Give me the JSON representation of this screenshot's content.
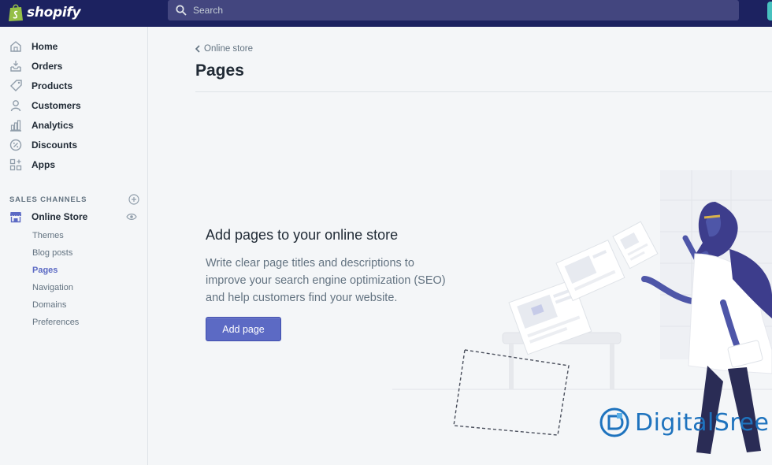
{
  "topbar": {
    "brand": "shopify",
    "search_placeholder": "Search"
  },
  "sidebar": {
    "items": [
      {
        "label": "Home",
        "icon": "home-icon"
      },
      {
        "label": "Orders",
        "icon": "orders-icon"
      },
      {
        "label": "Products",
        "icon": "tag-icon"
      },
      {
        "label": "Customers",
        "icon": "person-icon"
      },
      {
        "label": "Analytics",
        "icon": "bar-chart-icon"
      },
      {
        "label": "Discounts",
        "icon": "discount-icon"
      },
      {
        "label": "Apps",
        "icon": "apps-icon"
      }
    ],
    "sales_channels_label": "SALES CHANNELS",
    "online_store_label": "Online Store",
    "sub_items": [
      "Themes",
      "Blog posts",
      "Pages",
      "Navigation",
      "Domains",
      "Preferences"
    ],
    "active_sub_item": "Pages"
  },
  "main": {
    "breadcrumb": "Online store",
    "title": "Pages",
    "empty_state": {
      "heading": "Add pages to your online store",
      "description": "Write clear page titles and descriptions to improve your search engine optimization (SEO) and help customers find your website.",
      "button_label": "Add page"
    }
  },
  "watermark": {
    "text": "DigitalSree"
  },
  "colors": {
    "topbar": "#1c2260",
    "search_bg": "#43467f",
    "accent": "#5c6ac4",
    "text": "#212b36",
    "muted": "#637381",
    "watermark": "#1e73be"
  }
}
